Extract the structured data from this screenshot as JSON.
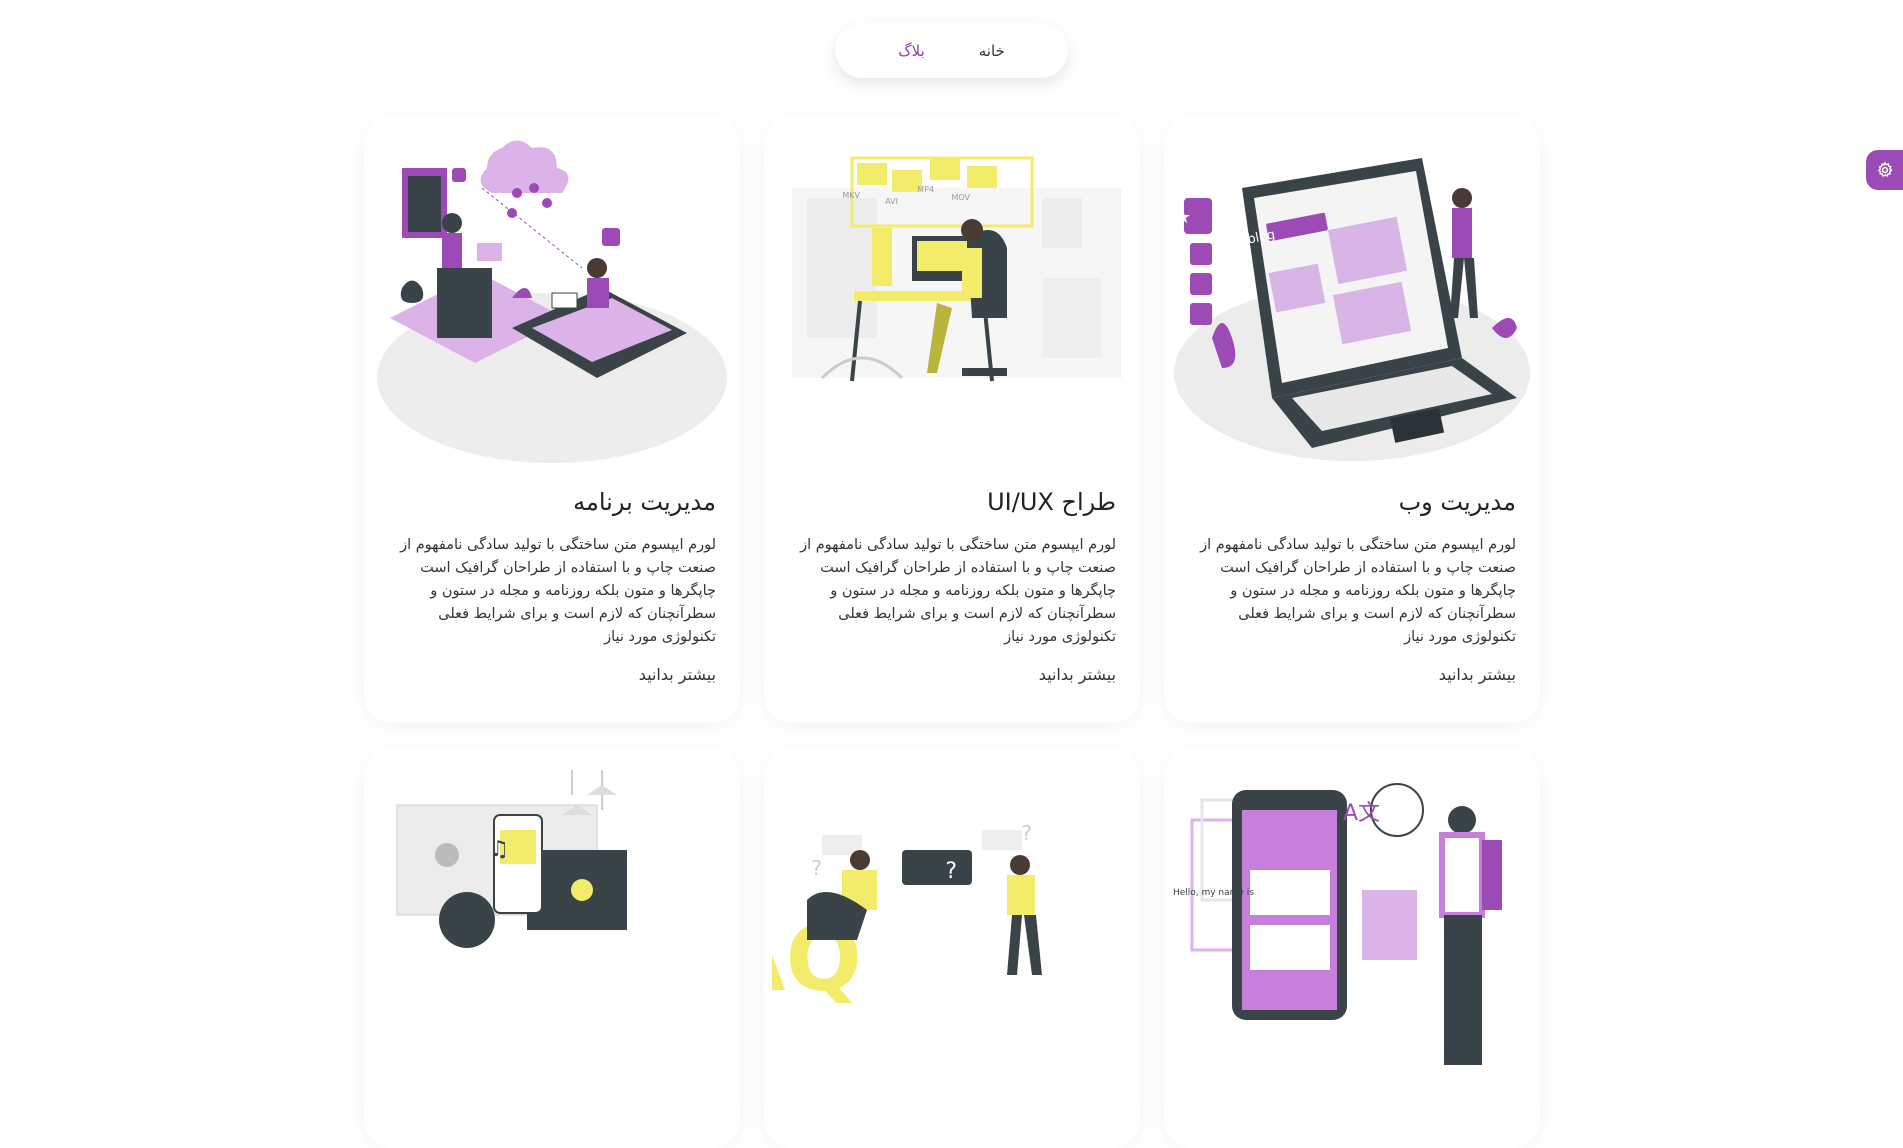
{
  "nav": {
    "home_label": "خانه",
    "blog_label": "بلاگ"
  },
  "colors": {
    "accent": "#9b4ab6",
    "nav_active": "#8b3ea3",
    "illustration_dark": "#3a4448",
    "illustration_yellow": "#f3ec6a"
  },
  "settings_button": {
    "icon": "gear-icon"
  },
  "cards": [
    {
      "title": "مدیریت وب",
      "description": "لورم ایپسوم متن ساختگی با تولید سادگی نامفهوم از صنعت چاپ و با استفاده از طراحان گرافیک است چاپگرها و متون بلکه روزنامه و مجله در ستون و سطرآنچنان که لازم است و برای شرایط فعلی تکنولوژی مورد نیاز",
      "more_label": "بیشتر بدانید",
      "illustration_text": "blog"
    },
    {
      "title": "طراح UI/UX",
      "description": "لورم ایپسوم متن ساختگی با تولید سادگی نامفهوم از صنعت چاپ و با استفاده از طراحان گرافیک است چاپگرها و متون بلکه روزنامه و مجله در ستون و سطرآنچنان که لازم است و برای شرایط فعلی تکنولوژی مورد نیاز",
      "more_label": "بیشتر بدانید",
      "illustration_labels": [
        "MKV",
        "AVI",
        "MP4",
        "MOV"
      ]
    },
    {
      "title": "مدیریت برنامه",
      "description": "لورم ایپسوم متن ساختگی با تولید سادگی نامفهوم از صنعت چاپ و با استفاده از طراحان گرافیک است چاپگرها و متون بلکه روزنامه و مجله در ستون و سطرآنچنان که لازم است و برای شرایط فعلی تکنولوژی مورد نیاز",
      "more_label": "بیشتر بدانید"
    },
    {
      "illustration_text": "Hello, my name is"
    },
    {
      "illustration_text": "FAQ"
    },
    {
      "illustration_icon": "music-note-icon"
    }
  ]
}
